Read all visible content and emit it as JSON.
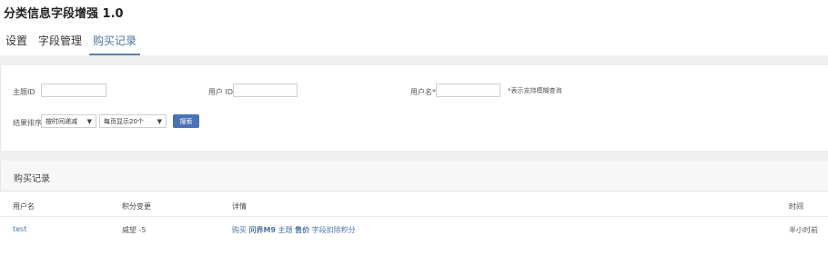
{
  "app": {
    "title": "分类信息字段增强 1.0"
  },
  "tabs": [
    {
      "label": "设置",
      "active": false
    },
    {
      "label": "字段管理",
      "active": false
    },
    {
      "label": "购买记录",
      "active": true
    }
  ],
  "filters": {
    "topic_id_label": "主题ID",
    "topic_id_value": "",
    "user_id_label": "用户 ID",
    "user_id_value": "",
    "username_label": "用户名*",
    "username_value": "",
    "fuzzy_hint": "*表示支持模糊查询",
    "sort_label": "结果排序",
    "sort_selected": "按时间递减",
    "per_page_selected": "每页显示20个",
    "search_label": "搜索"
  },
  "records": {
    "title": "购买记录",
    "columns": [
      "用户名",
      "积分变更",
      "详情",
      "时间"
    ],
    "rows": [
      {
        "username": "test",
        "credit_change": "威望 -5",
        "detail_prefix": "购买",
        "detail_topic": "问界M9",
        "detail_middle": "主题",
        "detail_field": "售价",
        "detail_suffix": "字段扣除积分",
        "time": "半小时前"
      }
    ]
  },
  "colors": {
    "accent": "#4d73a8",
    "button": "#4a72b6",
    "band": "#efefef"
  }
}
